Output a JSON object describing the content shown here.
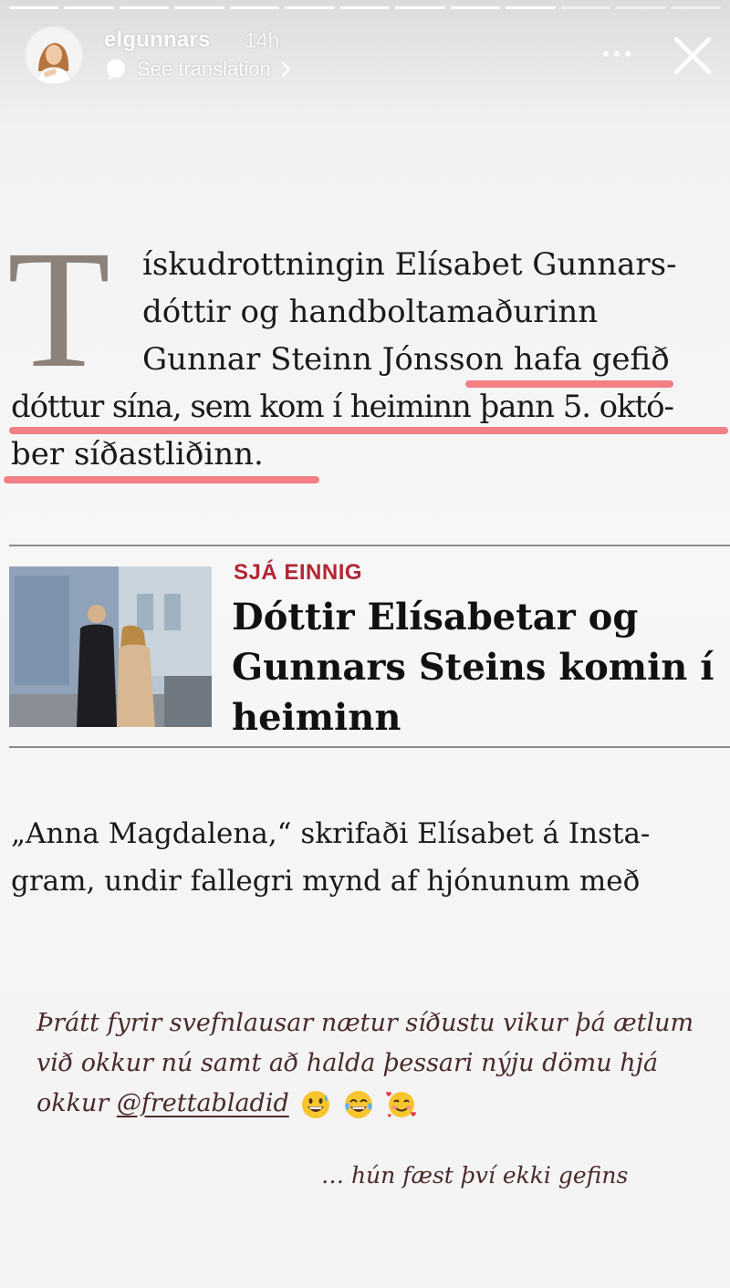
{
  "story": {
    "segments_total": 13,
    "segments_viewed": 10
  },
  "header": {
    "username": "elgunnars",
    "time": "14h",
    "see_translation": "See translation",
    "chevron": ">",
    "icons": {
      "avatar": "profile-photo",
      "translate": "translate-bubble-icon",
      "more": "more-dots-icon",
      "close": "close-icon"
    }
  },
  "article": {
    "dropcap": "T",
    "paragraph1_lines": [
      "ískudrottningin Elísabet Gunnars-",
      "dóttir og handboltamaðurinn",
      "Gunnar Steinn Jónsson hafa gefið",
      "dóttur sína, sem kom í heiminn þann 5. októ-",
      "ber síðastliðinn."
    ],
    "highlight_color": "#f07479",
    "kicker": "SJÁ EINNIG",
    "kicker_color": "#b32632",
    "headline": "Dóttir Elísabetar og\nGunnars Steins komin í\nheiminn",
    "paragraph2": "„Anna Magdalena,“ skrifaði Elísabet á Insta-\ngram, undir fallegri mynd af hjónunum með"
  },
  "caption": {
    "text_before": "Þrátt fyrir svefnlausar nætur síðustu vikur þá ætlum við okkur nú samt að halda þessari nýju dömu hjá okkur ",
    "mention": "@frettabladid",
    "emojis": [
      "grinning-sweat-emoji",
      "tears-of-joy-emoji",
      "smiling-hearts-emoji"
    ],
    "line2": "… hún fæst því ekki gefins",
    "color": "#4a2a2a"
  }
}
